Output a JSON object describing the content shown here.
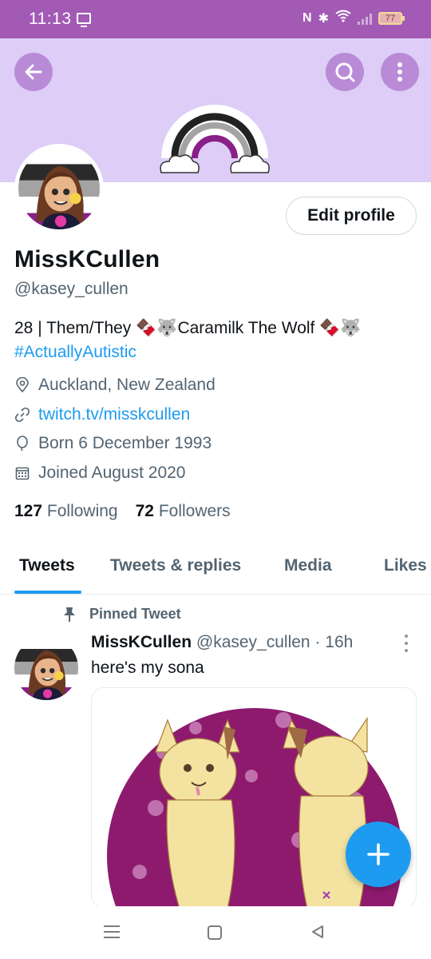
{
  "status_bar": {
    "time": "11:13",
    "nfc": "N",
    "bluetooth": "✱",
    "wifi": "ᯤ",
    "battery": "77"
  },
  "header": {
    "back_icon": "arrow-left-icon",
    "search_icon": "search-icon",
    "more_icon": "more-vertical-icon"
  },
  "profile": {
    "display_name": "MissKCullen",
    "handle": "@kasey_cullen",
    "edit_button": "Edit profile",
    "bio_line1_a": "28 | Them/They ",
    "bio_emoji_chocolate": "🍫",
    "bio_emoji_wolf": "🐺",
    "bio_line1_b": "Caramilk The Wolf ",
    "bio_hashtag": "#ActuallyAutistic",
    "location": "Auckland, New Zealand",
    "website": "twitch.tv/misskcullen",
    "birthday": "Born 6 December 1993",
    "joined": "Joined August 2020",
    "following_count": "127",
    "following_label": "Following",
    "followers_count": "72",
    "followers_label": "Followers"
  },
  "tabs": [
    {
      "label": "Tweets",
      "active": true
    },
    {
      "label": "Tweets & replies",
      "active": false
    },
    {
      "label": "Media",
      "active": false
    },
    {
      "label": "Likes",
      "active": false
    }
  ],
  "tweet": {
    "pinned_label": "Pinned Tweet",
    "author_name": "MissKCullen",
    "meta": "@kasey_cullen · 16h",
    "text": "here's my sona"
  },
  "colors": {
    "status_bar": "#a25ab5",
    "banner": "#ddcdf7",
    "banner_buttons": "#b98bd6",
    "accent": "#1d9bf0",
    "sona_background": "#8e1a6e"
  },
  "fab_icon": "plus-icon",
  "nav": {
    "menu_icon": "menu-icon",
    "home_icon": "home-square-icon",
    "back_icon": "back-triangle-icon"
  }
}
